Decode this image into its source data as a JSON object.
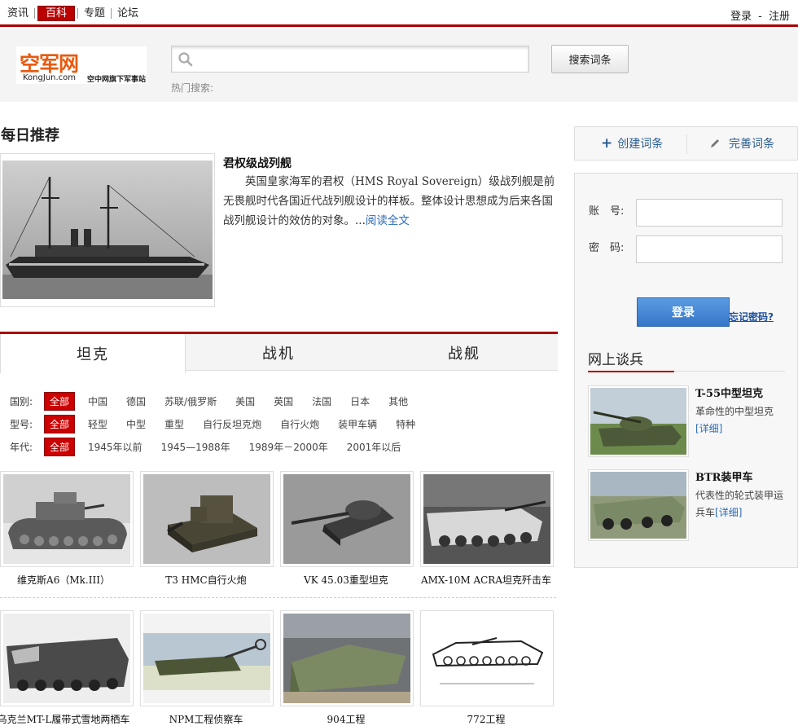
{
  "topbar": {
    "nav": [
      "资讯",
      "百科",
      "专题",
      "论坛"
    ],
    "active_index": 1,
    "login": "登录",
    "login_sep": "-",
    "register": "注册"
  },
  "header": {
    "logo_main": "空军网",
    "logo_domain": "KongJun.com",
    "logo_slogan": "空中网旗下军事站",
    "search_placeholder": "",
    "search_button": "搜索词条",
    "hot_label": "热门搜索:"
  },
  "daily": {
    "section_title": "每日推荐",
    "title": "君权级战列舰",
    "summary": "英国皇家海军的君权（HMS Royal Sovereign）级战列舰是前无畏舰时代各国近代战列舰设计的样板。整体设计思想成为后来各国战列舰设计的效仿的对象。...",
    "read_more": "阅读全文"
  },
  "tabs": [
    "坦克",
    "战机",
    "战舰"
  ],
  "filters": [
    {
      "label": "国别:",
      "options": [
        "全部",
        "中国",
        "德国",
        "苏联/俄罗斯",
        "美国",
        "英国",
        "法国",
        "日本",
        "其他"
      ]
    },
    {
      "label": "型号:",
      "options": [
        "全部",
        "轻型",
        "中型",
        "重型",
        "自行反坦克炮",
        "自行火炮",
        "装甲车辆",
        "特种"
      ]
    },
    {
      "label": "年代:",
      "options": [
        "全部",
        "1945年以前",
        "1945—1988年",
        "1989年－2000年",
        "2001年以后"
      ]
    }
  ],
  "vehicles": [
    {
      "name": "维克斯A6（Mk.III）"
    },
    {
      "name": "T3 HMC自行火炮"
    },
    {
      "name": "VK 45.03重型坦克"
    },
    {
      "name": "AMX-10M ACRA坦克歼击车"
    },
    {
      "name": "乌克兰MT-L履带式雪地两栖车"
    },
    {
      "name": "NPM工程侦察车"
    },
    {
      "name": "904工程"
    },
    {
      "name": "772工程"
    }
  ],
  "sidebar": {
    "create": "创建词条",
    "improve": "完善词条",
    "account_label": "账　号:",
    "password_label": "密　码:",
    "login_button": "登录",
    "forgot": "忘记密码?",
    "talk_title": "网上谈兵",
    "talk_items": [
      {
        "title": "T-55中型坦克",
        "desc": "革命性的中型坦克",
        "link": "[详细]"
      },
      {
        "title": "BTR装甲车",
        "desc": "代表性的轮式装甲运兵车",
        "link": "[详细]"
      }
    ]
  },
  "colors": {
    "accent": "#aa0000",
    "selected": "#cc0000",
    "link": "#2a6ab8",
    "login_button": "#4a8ad6"
  }
}
